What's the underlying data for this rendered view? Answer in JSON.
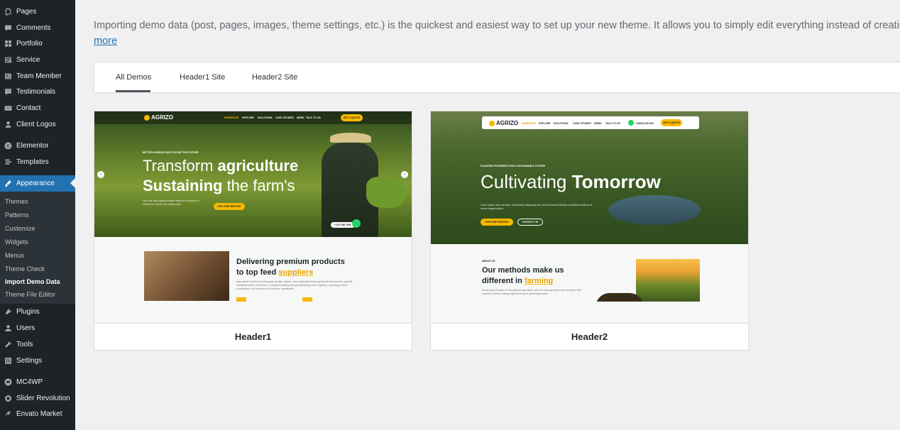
{
  "sidebar": {
    "items": [
      {
        "label": "Pages",
        "icon": "pages-icon"
      },
      {
        "label": "Comments",
        "icon": "comments-icon"
      },
      {
        "label": "Portfolio",
        "icon": "portfolio-icon"
      },
      {
        "label": "Service",
        "icon": "service-icon"
      },
      {
        "label": "Team Member",
        "icon": "team-member-icon"
      },
      {
        "label": "Testimonials",
        "icon": "testimonials-icon"
      },
      {
        "label": "Contact",
        "icon": "contact-icon"
      },
      {
        "label": "Client Logos",
        "icon": "client-logos-icon"
      },
      {
        "label": "Elementor",
        "icon": "elementor-icon"
      },
      {
        "label": "Templates",
        "icon": "templates-icon"
      },
      {
        "label": "Appearance",
        "icon": "appearance-icon"
      },
      {
        "label": "Plugins",
        "icon": "plugins-icon"
      },
      {
        "label": "Users",
        "icon": "users-icon"
      },
      {
        "label": "Tools",
        "icon": "tools-icon"
      },
      {
        "label": "Settings",
        "icon": "settings-icon"
      },
      {
        "label": "MC4WP",
        "icon": "mc4wp-icon"
      },
      {
        "label": "Slider Revolution",
        "icon": "slider-revolution-icon"
      },
      {
        "label": "Envato Market",
        "icon": "envato-market-icon"
      }
    ],
    "submenu": [
      "Themes",
      "Patterns",
      "Customize",
      "Widgets",
      "Menus",
      "Theme Check",
      "Import Demo Data",
      "Theme File Editor"
    ],
    "active_item": "Appearance",
    "current_submenu": "Import Demo Data"
  },
  "intro": {
    "text": "Importing demo data (post, pages, images, theme settings, etc.) is the quickest and easiest way to set up your new theme. It allows you to simply edit everything instead of creating co",
    "link": "more"
  },
  "tabs": [
    {
      "label": "All Demos",
      "active": true
    },
    {
      "label": "Header1 Site",
      "active": false
    },
    {
      "label": "Header2 Site",
      "active": false
    }
  ],
  "demos": [
    {
      "name": "Header1",
      "preview": {
        "logo": "AGRIZO",
        "nav": [
          "HOMEPAGE",
          "EXPLORE",
          "SOLUTIONS",
          "CASE STUDIES",
          "NEWS",
          "TALK TO US"
        ],
        "nav_button": "GET A QUOTE",
        "eyebrow": "BETTER AGRICULTURE FOR BETTER FUTURE",
        "headline_1a": "Transform ",
        "headline_1b": "agriculture",
        "headline_2a": "Sustaining",
        "headline_2b": " the farm's",
        "hero_text": "Your one stop digital software solutions company to deliver your ideas into cutting edge",
        "cta": "EXPLORE SERVICE",
        "phone": "+123 456 7890",
        "section_title_1": "Delivering premium products",
        "section_title_2a": "to top feed ",
        "section_title_2b": "suppliers",
        "section_text": "Agriculture involves providing high quality, reliable, and sustainable feed ingredients that meet the specific nutritional needs of livestock. It requires building strong relationships with suppliers, ensuring product consistency, and focusing on innovative, sustainable"
      }
    },
    {
      "name": "Header2",
      "preview": {
        "logo": "AGRIZO",
        "nav": [
          "HOMEPAGE",
          "EXPLORE",
          "SOLUTIONS",
          "CASE STUDIES",
          "NEWS",
          "TALK TO US"
        ],
        "phone": "+1(800) 000-000",
        "nav_button": "GET A QUOTE",
        "eyebrow": "PLANTING PROGRESS FOR A SUSTAINABLE FUTURE",
        "headline_a": "Cultivating ",
        "headline_b": "Tomorrow",
        "hero_text": "Lorem ipsum dolor sit amet, consectetur adipiscing elit, sed do eiusmod tempor incididunt ut labore et dolore magna aliqua",
        "cta": "EXPLORE SERVICE",
        "cta_2": "CONTACT US",
        "about_label": "ABOUT US",
        "section_title_1": "Our methods make us",
        "section_title_2a": "different in ",
        "section_title_2b": "farming",
        "section_text": "Combining 15 years of international agriculture and eco-farming experience, we strive with experts to deliver cutting edge solutions in global agriculture."
      }
    }
  ]
}
